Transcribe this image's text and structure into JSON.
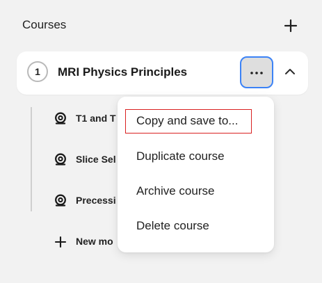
{
  "header": {
    "title": "Courses",
    "add_icon": "plus-icon"
  },
  "course": {
    "number": "1",
    "title": "MRI Physics Principles",
    "more_icon": "ellipsis-icon",
    "collapse_icon": "chevron-up-icon"
  },
  "modules": [
    {
      "label": "T1 and T",
      "icon": "module-icon"
    },
    {
      "label": "Slice Sel",
      "icon": "module-icon"
    },
    {
      "label": "Precessi",
      "icon": "module-icon"
    }
  ],
  "new_module": {
    "label": "New mo",
    "icon": "plus-icon"
  },
  "menu": {
    "items": [
      {
        "label": "Copy and save to..."
      },
      {
        "label": "Duplicate course"
      },
      {
        "label": "Archive course"
      },
      {
        "label": "Delete course"
      }
    ]
  },
  "colors": {
    "background": "#f2f2f2",
    "focus_ring": "#3b82f6",
    "highlight_border": "#d92020"
  }
}
